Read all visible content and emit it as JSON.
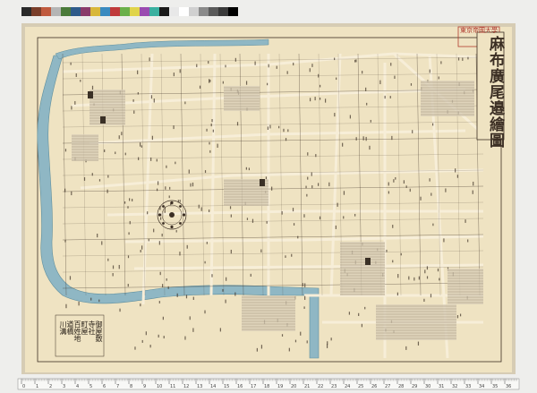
{
  "map": {
    "title": "麻布廣尾邉繪圖",
    "seal": "東京帝國大學"
  },
  "color_bar": {
    "swatches": [
      "#2a2a2a",
      "#7a3e2a",
      "#c05a3e",
      "#b5b5b5",
      "#4a7a3a",
      "#2e5a8a",
      "#8a3a6a",
      "#d8b73a",
      "#3a8ac0",
      "#c03a3a",
      "#6ab04a",
      "#e0d44a",
      "#9a4ab0",
      "#3ab0a0",
      "#1a1a1a",
      "#e8e8e8",
      "#ffffff",
      "#d0d0d0",
      "#8a8a8a",
      "#5a5a5a",
      "#3a3a3a",
      "#000000"
    ]
  },
  "ruler": {
    "labels": [
      "0",
      "1",
      "2",
      "3",
      "4",
      "5",
      "6",
      "7",
      "8",
      "9",
      "10",
      "11",
      "12",
      "13",
      "14",
      "15",
      "16",
      "17",
      "18",
      "19",
      "20",
      "21",
      "22",
      "23",
      "24",
      "25",
      "26",
      "27",
      "28",
      "29",
      "30",
      "31",
      "32",
      "33",
      "34",
      "35",
      "36"
    ]
  },
  "legend": {
    "columns": [
      "御屋敷",
      "寺社",
      "町屋",
      "百姓地",
      "道橋",
      "川溝"
    ]
  },
  "colors": {
    "paper": "#efe3c2",
    "paper_dark": "#e3d4ae",
    "river": "#8fb7c4",
    "river_edge": "#5f8f9e",
    "road": "#f4ead2",
    "ink": "#3c2f24",
    "town": "#d9cfb8",
    "seal": "#b03a2e"
  }
}
